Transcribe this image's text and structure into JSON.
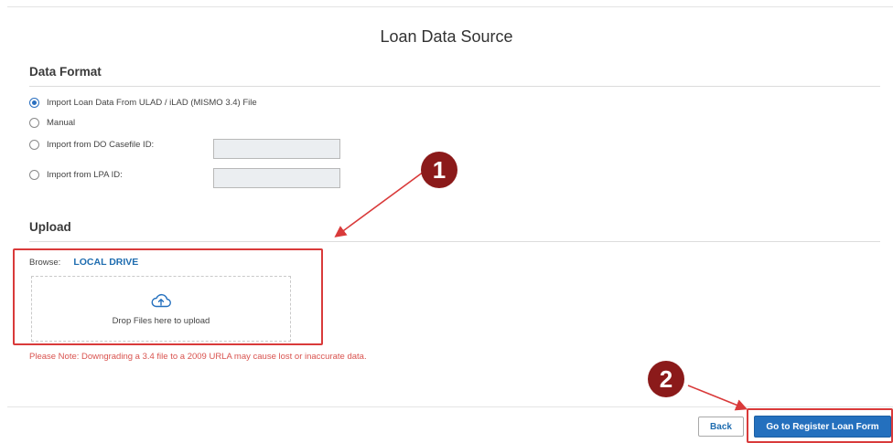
{
  "page_title": "Loan Data Source",
  "data_format": {
    "title": "Data Format",
    "options": [
      {
        "label": "Import Loan Data From ULAD / iLAD (MISMO 3.4) File",
        "selected": true
      },
      {
        "label": "Manual",
        "selected": false
      },
      {
        "label": "Import from DO Casefile ID:",
        "selected": false
      },
      {
        "label": "Import from LPA ID:",
        "selected": false
      }
    ],
    "do_casefile_value": "",
    "lpa_id_value": ""
  },
  "upload": {
    "title": "Upload",
    "browse_label": "Browse:",
    "local_drive_label": "LOCAL DRIVE",
    "upload_icon": "cloud-upload-icon",
    "drop_text": "Drop Files here to upload"
  },
  "note": "Please Note: Downgrading a 3.4 file to a 2009 URLA may cause lost or inaccurate data.",
  "footer": {
    "back_label": "Back",
    "register_label": "Go to Register Loan Form"
  },
  "annotations": {
    "badge_1": "1",
    "badge_2": "2",
    "color": "#8b1a1a",
    "highlight_color": "#d93a3a"
  },
  "colors": {
    "accent": "#2470be",
    "link": "#1f6db0",
    "warning_text": "#d9534f"
  }
}
